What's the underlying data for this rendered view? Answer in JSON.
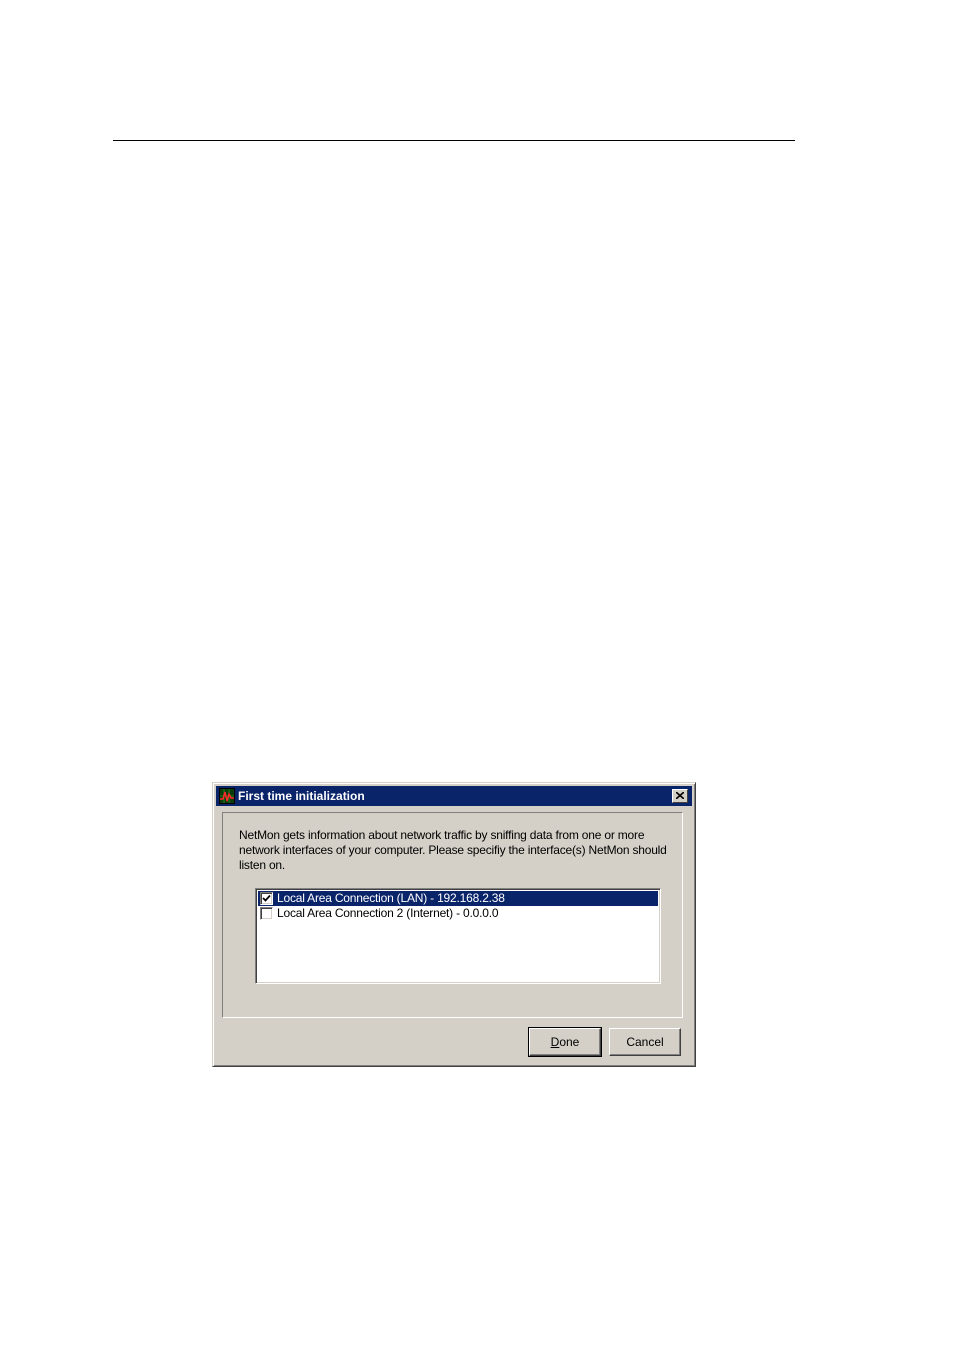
{
  "dialog": {
    "title": "First time initialization",
    "description": "NetMon gets information about network traffic by sniffing data from one or more network interfaces of your computer. Please specifiy the interface(s) NetMon should listen on.",
    "interfaces": [
      {
        "label": "Local Area Connection (LAN) - 192.168.2.38",
        "checked": true,
        "selected": true
      },
      {
        "label": "Local Area Connection 2 (Internet) - 0.0.0.0",
        "checked": false,
        "selected": false
      }
    ],
    "buttons": {
      "done_accel": "D",
      "done_rest": "one",
      "cancel": "Cancel"
    }
  },
  "icons": {
    "app": "netmon-graph-icon",
    "close": "close-icon",
    "check": "checkmark-icon"
  },
  "colors": {
    "titlebar": "#0a246a",
    "face": "#d4d0c8",
    "selection": "#0a246a"
  }
}
